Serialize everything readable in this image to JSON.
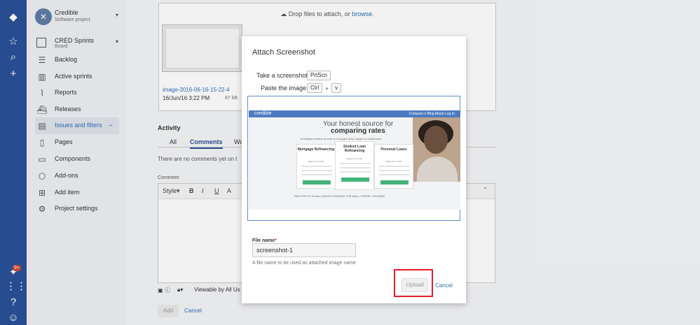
{
  "sidebar": {
    "project_name": "Credible",
    "project_type": "Software project",
    "board_name": "CRED Sprints",
    "board_type": "Board",
    "items": [
      {
        "label": "Backlog",
        "icon": "backlog-icon"
      },
      {
        "label": "Active sprints",
        "icon": "columns-icon"
      },
      {
        "label": "Reports",
        "icon": "chart-icon"
      },
      {
        "label": "Releases",
        "icon": "ship-icon"
      },
      {
        "label": "Issues and filters",
        "icon": "issues-icon"
      },
      {
        "label": "Pages",
        "icon": "page-icon"
      },
      {
        "label": "Components",
        "icon": "components-icon"
      },
      {
        "label": "Add-ons",
        "icon": "addons-icon"
      },
      {
        "label": "Add item",
        "icon": "add-item-icon"
      },
      {
        "label": "Project settings",
        "icon": "gear-icon"
      }
    ],
    "active_item": "Issues and filters"
  },
  "global_nav": {
    "notification_badge": "9+"
  },
  "attachments": {
    "drop_text": "Drop files to attach, or ",
    "drop_link": "browse.",
    "file_name": "image-2016-06-16-15-22-4",
    "file_date": "16/Jun/16 3:22 PM",
    "file_size": "87 kB"
  },
  "activity": {
    "title": "Activity",
    "tabs": [
      "All",
      "Comments",
      "Wo"
    ],
    "active_tab": "Comments",
    "no_comments": "There are no comments yet on t",
    "comment_label": "Comment",
    "toolbar": {
      "style": "Style",
      "bold": "B",
      "italic": "I",
      "underline": "U",
      "color": "A"
    },
    "viewable_by": "Viewable by All Us",
    "add_label": "Add",
    "cancel_label": "Cancel"
  },
  "dialog": {
    "title": "Attach Screenshot",
    "take_label": "Take a screenshot:",
    "take_key": "PrtScn",
    "paste_label": "Paste the image:",
    "paste_key1": "Ctrl",
    "paste_plus": "+",
    "paste_key2": "v",
    "pasted_image": {
      "logo": "credible",
      "menu": "Compare ▾  Blog  About  Log In",
      "headline1": "Your honest source for",
      "headline2": "comparing rates",
      "features": "● Multiple lenders at once  ● Compare  ● No impact to credit score",
      "cards": [
        {
          "title": "Mortgage Refinancing",
          "sub": "Rates from 3.5%"
        },
        {
          "title": "Student Loan Refinancing",
          "sub": "Rates from 2.1%"
        },
        {
          "title": "Personal Loans",
          "sub": "Rates from 4.9%"
        }
      ],
      "press": "TRUSTPILOT  Forbes  YAHOO! FINANCE  THE WALL STREET JOURNAL"
    },
    "file_name_label": "File name",
    "file_name_required": "*",
    "file_name_value": "screenshot-1",
    "file_name_help": "A file name to be used as attached image name",
    "upload_label": "Upload",
    "cancel_label": "Cancel"
  }
}
